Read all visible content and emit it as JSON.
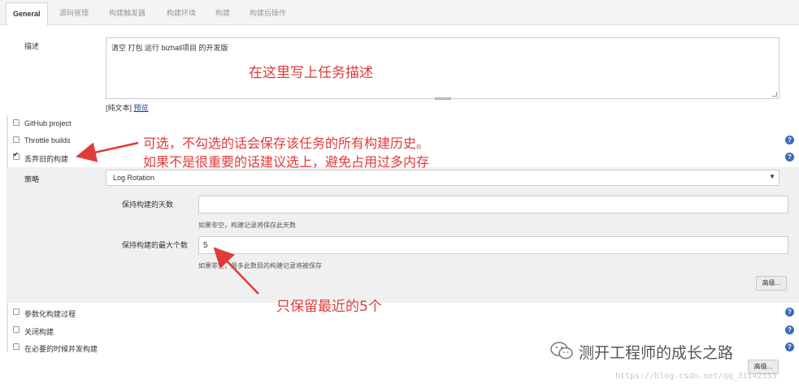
{
  "tabs": [
    "General",
    "源码管理",
    "构建触发器",
    "构建环境",
    "构建",
    "构建后操作"
  ],
  "description": {
    "label": "描述",
    "value": "清空 打包 运行 bizhall项目 的开发版",
    "plain_text": "[纯文本]",
    "preview": "预览"
  },
  "options": {
    "github_project": "GitHub project",
    "throttle_builds": "Throttle builds",
    "discard_old_builds": "丢弃旧的构建",
    "parameterized": "参数化构建过程",
    "disable_build": "关闭构建",
    "concurrent_builds": "在必要的时候并发构建"
  },
  "discard": {
    "strategy_label": "策略",
    "strategy_value": "Log Rotation",
    "days_label": "保持构建的天数",
    "days_value": "",
    "days_hint": "如果非空，构建记录将保存此天数",
    "max_label": "保持构建的最大个数",
    "max_value": "5",
    "max_hint": "如果非空，最多此数目的构建记录将被保存",
    "advanced": "高级..."
  },
  "bottom_advanced": "高级...",
  "annotations": {
    "desc_note": "在这里写上任务描述",
    "discard_note_1": "可选，不勾选的话会保存该任务的所有构建历史。",
    "discard_note_2": "如果不是很重要的话建议选上，避免占用过多内存",
    "keep5_note": "只保留最近的5个"
  },
  "watermark": {
    "text": "测开工程师的成长之路",
    "url": "https://blog.csdn.net/qq_31142553"
  },
  "colors": {
    "annotation": "#e23a3a",
    "help_icon": "#3a6ab8"
  }
}
